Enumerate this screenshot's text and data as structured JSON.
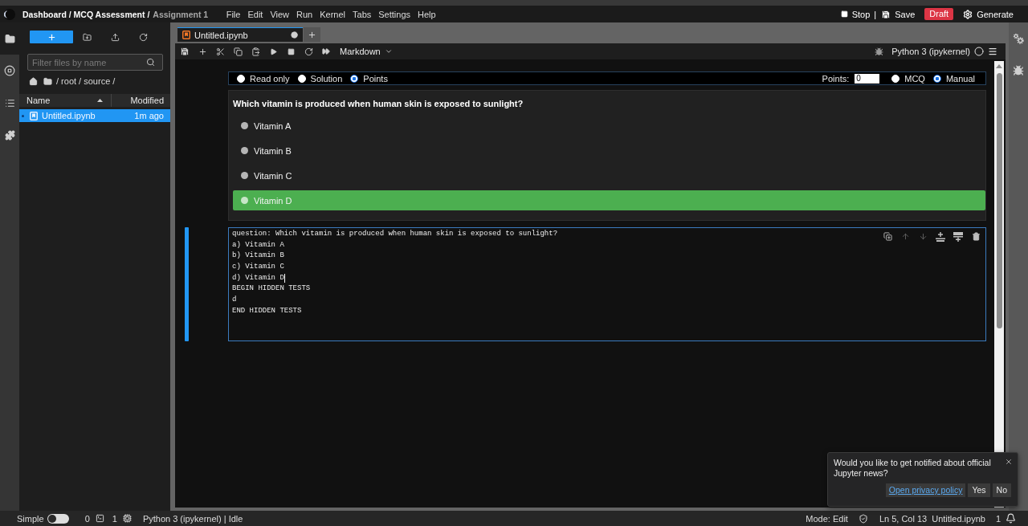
{
  "top_bar": {
    "breadcrumb": [
      {
        "label": "Dashboard / MCQ Assessment /",
        "current": false
      },
      {
        "label": "Assignment 1",
        "current": true
      }
    ],
    "menu": [
      "File",
      "Edit",
      "View",
      "Run",
      "Kernel",
      "Tabs",
      "Settings",
      "Help"
    ],
    "actions": [
      {
        "kind": "stop",
        "label": "Stop"
      },
      {
        "kind": "divider",
        "label": "|"
      },
      {
        "kind": "save",
        "label": "Save"
      },
      {
        "kind": "badge",
        "label": "Draft"
      },
      {
        "kind": "generate",
        "label": "Generate"
      }
    ]
  },
  "left_sidebar": {
    "tabs": [
      {
        "kind": "files",
        "selected": true
      },
      {
        "kind": "running",
        "selected": false
      },
      {
        "kind": "toc",
        "selected": false
      },
      {
        "kind": "extensions",
        "selected": false
      }
    ]
  },
  "file_browser": {
    "filter": {
      "placeholder": "Filter files by name"
    },
    "path": "/ root / source /",
    "columns": [
      {
        "label": "Name",
        "sorted": true
      },
      {
        "label": "Modified",
        "sorted": false
      }
    ],
    "files": [
      {
        "name": "Untitled.ipynb",
        "modified": "1m ago",
        "selected": true,
        "running": true
      }
    ]
  },
  "notebook_tabs": [
    {
      "label": "Untitled.ipynb",
      "selected": true,
      "dirty": true
    }
  ],
  "notebook_toolbar": {
    "cell_type": "Markdown",
    "kernel": "Python 3 (ipykernel)",
    "kernel_busy": false
  },
  "cells": [
    {
      "kind": "rendered",
      "active": false,
      "modes": [
        {
          "label": "Read only",
          "selected": false
        },
        {
          "label": "Solution",
          "selected": false
        },
        {
          "label": "Points",
          "selected": true
        }
      ],
      "points_label": "Points:",
      "points": "0",
      "grading": [
        {
          "label": "MCQ",
          "selected": false
        },
        {
          "label": "Manual",
          "selected": true
        }
      ],
      "question": "Which vitamin is produced when human skin is exposed to sunlight?",
      "answers": [
        {
          "label": "Vitamin A",
          "selected": false
        },
        {
          "label": "Vitamin B",
          "selected": false
        },
        {
          "label": "Vitamin C",
          "selected": false
        },
        {
          "label": "Vitamin D",
          "selected": true
        }
      ]
    },
    {
      "kind": "editor",
      "active": true,
      "tools": [
        {
          "kind": "duplicate",
          "disabled": false
        },
        {
          "kind": "up",
          "disabled": true
        },
        {
          "kind": "down",
          "disabled": true
        },
        {
          "kind": "insert_above",
          "disabled": false
        },
        {
          "kind": "insert_below",
          "disabled": false
        },
        {
          "kind": "delete",
          "disabled": false
        }
      ],
      "lines": [
        {
          "text": "question: Which vitamin is produced when human skin is exposed to sunlight?",
          "cursor": false
        },
        {
          "text": "a) Vitamin A",
          "cursor": false
        },
        {
          "text": "b) Vitamin B",
          "cursor": false
        },
        {
          "text": "c) Vitamin C",
          "cursor": false
        },
        {
          "text": "d) Vitamin D",
          "cursor": true
        },
        {
          "text": "BEGIN HIDDEN TESTS",
          "cursor": false
        },
        {
          "text": "d",
          "cursor": false
        },
        {
          "text": "END HIDDEN TESTS",
          "cursor": false
        }
      ]
    }
  ],
  "notification": {
    "message": "Would you like to get notified about official Jupyter news?",
    "link": "Open privacy policy",
    "buttons": [
      "Yes",
      "No"
    ]
  },
  "status_bar": {
    "simple_mode": {
      "label": "Simple",
      "on": false
    },
    "terminals": "0",
    "kernels": "1",
    "kernel_status": "Python 3 (ipykernel) | Idle",
    "mode": "Mode: Edit",
    "position": "Ln 5, Col 13",
    "file": "Untitled.ipynb",
    "notifications": "1"
  }
}
